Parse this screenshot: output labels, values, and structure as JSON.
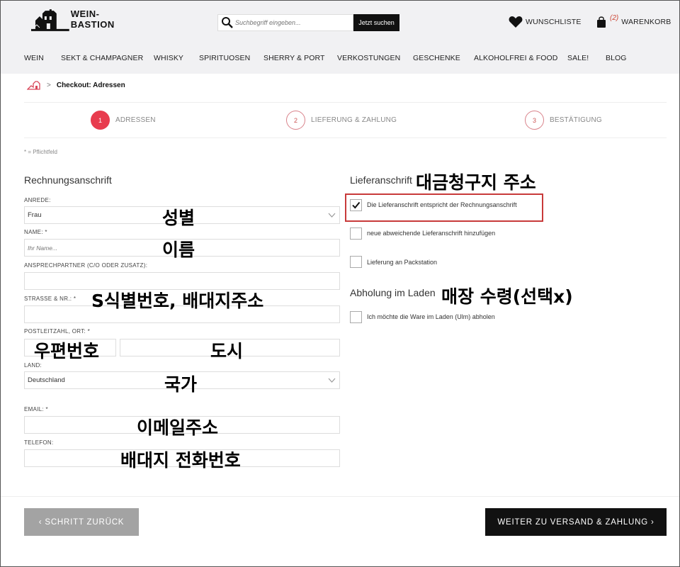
{
  "header": {
    "logo_text": "WEIN-BASTION",
    "search_placeholder": "Suchbegriff eingeben...",
    "search_button": "Jetzt suchen",
    "wishlist_label": "WUNSCHLISTE",
    "cart_count": "(2)",
    "cart_label": "WARENKORB"
  },
  "nav": {
    "items": [
      "WEIN",
      "SEKT & CHAMPAGNER",
      "WHISKY",
      "SPIRITUOSEN",
      "SHERRY & PORT",
      "VERKOSTUNGEN",
      "GESCHENKE",
      "ALKOHOLFREI & FOOD",
      "SALE!",
      "BLOG"
    ]
  },
  "breadcrumb": {
    "separator": ">",
    "current": "Checkout: Adressen"
  },
  "steps": [
    {
      "number": "1",
      "label": "ADRESSEN",
      "active": true
    },
    {
      "number": "2",
      "label": "LIEFERUNG & ZAHLUNG",
      "active": false
    },
    {
      "number": "3",
      "label": "BESTÄTIGUNG",
      "active": false
    }
  ],
  "required_note": "* = Pflichtfeld",
  "billing": {
    "title": "Rechnungsanschrift",
    "salutation_label": "ANREDE:",
    "salutation_value": "Frau",
    "name_label": "NAME: *",
    "name_placeholder": "Ihr Name...",
    "contact_label": "ANSPRECHPARTNER (C/O ODER ZUSATZ):",
    "street_label": "STRASSE & NR.: *",
    "zip_city_label": "POSTLEITZAHL, ORT: *",
    "country_label": "LAND:",
    "country_value": "Deutschland",
    "email_label": "EMAIL: *",
    "phone_label": "TELEFON:"
  },
  "shipping": {
    "title": "Lieferanschrift",
    "same_address_label": "Die Lieferanschrift entspricht der Rechnungsanschrift",
    "same_address_checked": true,
    "new_address_label": "neue abweichende Lieferanschrift hinzufügen",
    "packstation_label": "Lieferung an Packstation",
    "pickup_title": "Abholung im Laden",
    "pickup_label": "Ich möchte die Ware im Laden (Ulm) abholen"
  },
  "annotations": {
    "shipping_title": "대금청구지 주소",
    "salutation": "성별",
    "name": "이름",
    "street": "S식별번호, 배대지주소",
    "zip": "우편번호",
    "city": "도시",
    "country": "국가",
    "pickup": "매장 수령(선택x)",
    "email": "이메일주소",
    "phone": "배대지 전화번호"
  },
  "buttons": {
    "back": "‹ SCHRITT ZURÜCK",
    "next": "WEITER ZU VERSAND & ZAHLUNG ›"
  },
  "colors": {
    "accent_red": "#e83c4e",
    "highlight_box": "#c83a3a",
    "header_bg": "#f1f1f3"
  }
}
